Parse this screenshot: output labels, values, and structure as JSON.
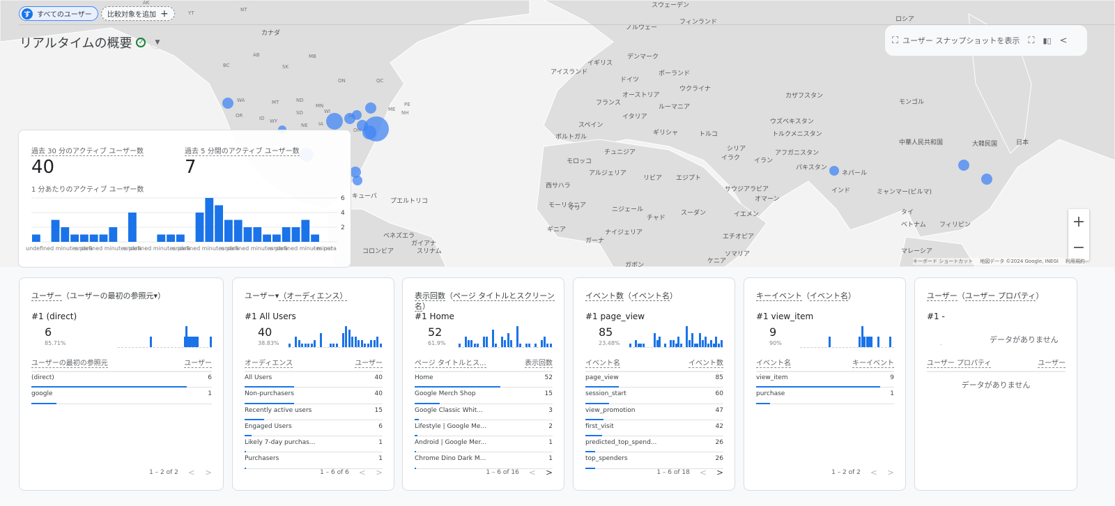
{
  "header": {
    "segment_chip": "すべてのユーザー",
    "segment_avatar": "す",
    "add_comparison": "比較対象を追加",
    "page_title": "リアルタイムの概要"
  },
  "snapshot": {
    "label": "ユーザー スナップショットを表示"
  },
  "map": {
    "labels": [
      "カナダ",
      "アイスランド",
      "イギリス",
      "デンマーク",
      "ノルウェー",
      "スウェーデン",
      "フィンランド",
      "ロシア",
      "ドイツ",
      "ポーランド",
      "ウクライナ",
      "オーストリア",
      "フランス",
      "イタリア",
      "ルーマニア",
      "カザフスタン",
      "モンゴル",
      "スペイン",
      "ポルトガル",
      "ギリシャ",
      "トルコ",
      "ウズベキスタン",
      "トルクメニスタン",
      "中華人民共和国",
      "大韓民国",
      "日本",
      "モロッコ",
      "チュニジア",
      "シリア",
      "イラク",
      "アフガニスタン",
      "イラン",
      "パキスタン",
      "ネパール",
      "アルジェリア",
      "リビア",
      "エジプト",
      "サウジアラビア",
      "インド",
      "ミャンマー(ビルマ)",
      "西サハラ",
      "モーリタニア",
      "マリ",
      "ニジェール",
      "スーダン",
      "オマーン",
      "イエメン",
      "タイ",
      "ギニア",
      "ナイジェリア",
      "チャド",
      "エチオピア",
      "ガーナ",
      "ベトナム",
      "フィリピン",
      "ソマリア",
      "ケニア",
      "ガボン",
      "マレーシア",
      "ベネズエラ",
      "ガイアナ",
      "スリナム",
      "コロンビア",
      "プエルトリコ",
      "キューバ"
    ],
    "region_labels": [
      "AK",
      "NT",
      "YT",
      "AB",
      "BC",
      "SK",
      "MB",
      "ON",
      "QC",
      "WA",
      "OR",
      "ID",
      "MT",
      "WY",
      "ND",
      "SD",
      "NE",
      "MN",
      "IA",
      "WI",
      "MI",
      "OH",
      "PE",
      "NH",
      "ME"
    ],
    "zoom_in": "+",
    "zoom_out": "−",
    "attribution": {
      "shortcuts": "キーボード ショートカット",
      "data": "地図データ ©2024 Google, INEGI",
      "terms": "利用規約"
    }
  },
  "summary": {
    "active30_label": "過去 30 分のアクティブ ユーザー数",
    "active30_value": "40",
    "active5_label": "過去 5 分間のアクティブ ユーザー数",
    "active5_value": "7",
    "per_minute_label": "1 分あたりのアクティブ ユーザー数"
  },
  "chart_data": {
    "type": "bar",
    "values": [
      1,
      0,
      3,
      2,
      1,
      1,
      1,
      1,
      2,
      0,
      4,
      0,
      0,
      1,
      1,
      1,
      0,
      4,
      6,
      5,
      3,
      3,
      2,
      2,
      1,
      1,
      2,
      2,
      3,
      1
    ],
    "ylim": [
      0,
      6
    ],
    "yticks": [
      2,
      4,
      6
    ],
    "xtick_label": "undefined minutes para",
    "xtick_tail": "- minut",
    "grid": true,
    "color": "#1a73e8"
  },
  "cards": [
    {
      "title": [
        {
          "t": "ユーザー",
          "u": true
        },
        {
          "t": "（ユーザーの最初の参照元▾）",
          "u": false
        }
      ],
      "top_label": "#1  (direct)",
      "top_value": "6",
      "top_pct": "85.71%",
      "spark": [
        0,
        0,
        0,
        0,
        0,
        0,
        0,
        0,
        0,
        0,
        0,
        0,
        0,
        0,
        0,
        0,
        0,
        2,
        0,
        0,
        0,
        0,
        0,
        0,
        0,
        0,
        0,
        0,
        0,
        0,
        0,
        0,
        0,
        0,
        0,
        2,
        4,
        2,
        2,
        2,
        2,
        2,
        2,
        0,
        0,
        0,
        0,
        0,
        0,
        2
      ],
      "col1": "ユーザーの最初の参照元",
      "col2": "ユーザー",
      "rows": [
        {
          "l": "(direct)",
          "v": "6",
          "f": 0.86
        },
        {
          "l": "google",
          "v": "1",
          "f": 0.14
        }
      ],
      "pagination": "1 – 2 of 2",
      "next_enabled": false
    },
    {
      "title": [
        {
          "t": "ユーザー▾",
          "u": false
        },
        {
          "t": "（オーディエンス）",
          "u": true
        }
      ],
      "top_label": "#1  All Users",
      "top_value": "40",
      "top_pct": "38.83%",
      "spark": [
        1,
        0,
        3,
        2,
        1,
        1,
        1,
        1,
        2,
        0,
        4,
        0,
        0,
        1,
        1,
        1,
        0,
        4,
        6,
        5,
        3,
        3,
        2,
        2,
        1,
        1,
        2,
        2,
        3,
        1
      ],
      "col1": "オーディエンス",
      "col2": "ユーザー",
      "rows": [
        {
          "l": "All Users",
          "v": "40",
          "f": 0.36
        },
        {
          "l": "Non-purchasers",
          "v": "40",
          "f": 0.36
        },
        {
          "l": "Recently active users",
          "v": "15",
          "f": 0.14
        },
        {
          "l": "Engaged Users",
          "v": "6",
          "f": 0.05
        },
        {
          "l": "Likely 7-day purchas...",
          "v": "1",
          "f": 0.01
        },
        {
          "l": "Purchasers",
          "v": "1",
          "f": 0.01
        }
      ],
      "pagination": "1 – 6 of 6",
      "next_enabled": false
    },
    {
      "title": [
        {
          "t": "表示回数",
          "u": true
        },
        {
          "t": "（",
          "u": false
        },
        {
          "t": "ページ タイトルとスクリーン名",
          "u": true
        },
        {
          "t": "）",
          "u": false
        }
      ],
      "top_label": "#1  Home",
      "top_value": "52",
      "top_pct": "61.9%",
      "spark": [
        1,
        0,
        3,
        2,
        2,
        1,
        1,
        0,
        3,
        3,
        0,
        5,
        1,
        0,
        3,
        2,
        4,
        2,
        0,
        6,
        1,
        0,
        1,
        1,
        0,
        1,
        0,
        2,
        3,
        1,
        1
      ],
      "col1": "ページ タイトルとス...",
      "col2": "表示回数",
      "rows": [
        {
          "l": "Home",
          "v": "52",
          "f": 0.62
        },
        {
          "l": "Google Merch Shop",
          "v": "15",
          "f": 0.18
        },
        {
          "l": "Google Classic Whit...",
          "v": "3",
          "f": 0.03
        },
        {
          "l": "Lifestyle | Google Me...",
          "v": "2",
          "f": 0.02
        },
        {
          "l": "Android | Google Mer...",
          "v": "1",
          "f": 0.01
        },
        {
          "l": "Chrome Dino Dark M...",
          "v": "1",
          "f": 0.01
        }
      ],
      "pagination": "1 – 6 of 16",
      "next_enabled": true
    },
    {
      "title": [
        {
          "t": "イベント数",
          "u": true
        },
        {
          "t": "（",
          "u": false
        },
        {
          "t": "イベント名",
          "u": true
        },
        {
          "t": "）",
          "u": false
        }
      ],
      "top_label": "#1  page_view",
      "top_value": "85",
      "top_pct": "23.48%",
      "spark": [
        1,
        0,
        2,
        1,
        1,
        1,
        0,
        0,
        0,
        4,
        2,
        3,
        0,
        1,
        0,
        2,
        2,
        1,
        3,
        1,
        0,
        6,
        2,
        4,
        1,
        1,
        4,
        2,
        3,
        1,
        2,
        1,
        3,
        1,
        2
      ],
      "col1": "イベント名",
      "col2": "イベント数",
      "rows": [
        {
          "l": "page_view",
          "v": "85",
          "f": 0.24
        },
        {
          "l": "session_start",
          "v": "60",
          "f": 0.17
        },
        {
          "l": "view_promotion",
          "v": "47",
          "f": 0.13
        },
        {
          "l": "first_visit",
          "v": "42",
          "f": 0.12
        },
        {
          "l": "predicted_top_spend...",
          "v": "26",
          "f": 0.07
        },
        {
          "l": "top_spenders",
          "v": "26",
          "f": 0.07
        }
      ],
      "pagination": "1 – 6 of 18",
      "next_enabled": true
    },
    {
      "title": [
        {
          "t": "キーイベント",
          "u": true
        },
        {
          "t": "（",
          "u": false
        },
        {
          "t": "イベント名",
          "u": true
        },
        {
          "t": "）",
          "u": false
        }
      ],
      "top_label": "#1  view_item",
      "top_value": "9",
      "top_pct": "90%",
      "spark": [
        0,
        0,
        0,
        0,
        0,
        0,
        0,
        0,
        0,
        0,
        0,
        0,
        2,
        0,
        0,
        0,
        0,
        0,
        0,
        0,
        0,
        0,
        0,
        0,
        0,
        2,
        4,
        2,
        2,
        2,
        2,
        0,
        0,
        2,
        0,
        0,
        0,
        0,
        2,
        0
      ],
      "col1": "イベント名",
      "col2": "キーイベント",
      "rows": [
        {
          "l": "view_item",
          "v": "9",
          "f": 0.9
        },
        {
          "l": "purchase",
          "v": "1",
          "f": 0.1
        }
      ],
      "pagination": "1 – 2 of 2",
      "next_enabled": false
    },
    {
      "title": [
        {
          "t": "ユーザー",
          "u": true
        },
        {
          "t": "（",
          "u": false
        },
        {
          "t": "ユーザー プロパティ",
          "u": true
        },
        {
          "t": "）",
          "u": false
        }
      ],
      "top_label": "#1  -",
      "top_value": "",
      "top_pct": ".",
      "spark": [],
      "no_data": "データがありません",
      "col1": "ユーザー プロパティ",
      "col2": "ユーザー",
      "rows": [],
      "table_no_data": "データがありません",
      "pagination": "",
      "next_enabled": false
    }
  ]
}
